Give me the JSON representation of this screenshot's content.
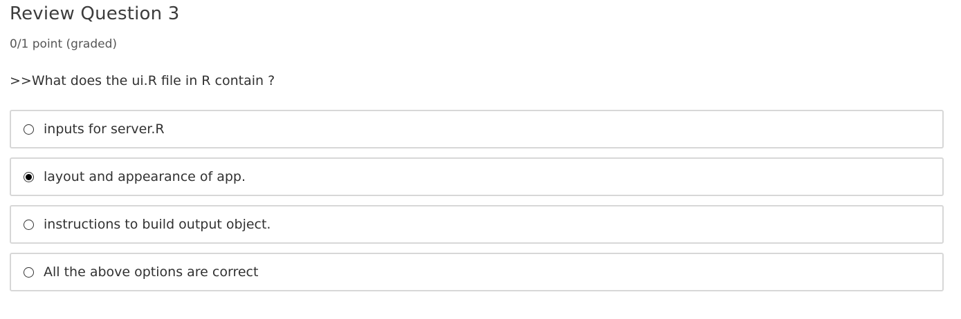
{
  "problem": {
    "title": "Review Question 3",
    "points": "0/1 point (graded)",
    "question": ">>What does the ui.R file in R contain ?"
  },
  "options": [
    {
      "label": "inputs for server.R",
      "selected": false
    },
    {
      "label": "layout and appearance of app.",
      "selected": true
    },
    {
      "label": "instructions to build output object.",
      "selected": false
    },
    {
      "label": "All the above options are correct",
      "selected": false
    }
  ]
}
